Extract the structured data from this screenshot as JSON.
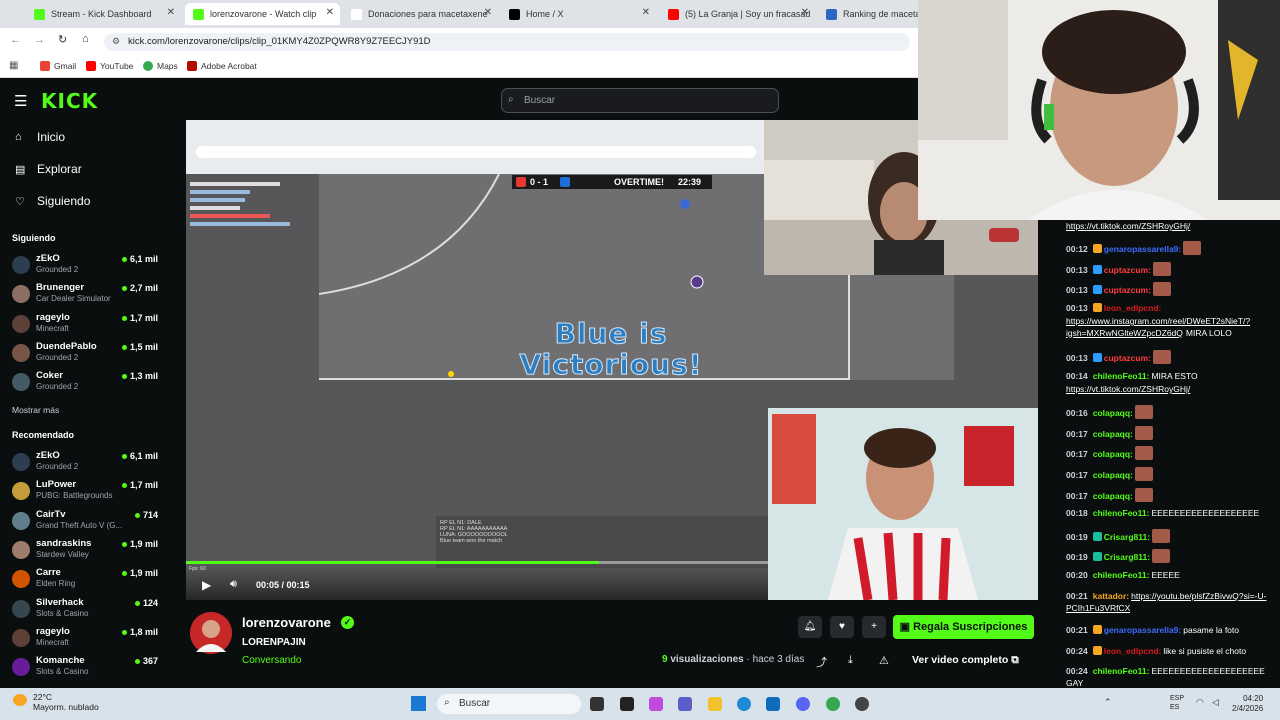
{
  "browser": {
    "tabs": [
      {
        "title": "Stream - Kick Dashboard",
        "color": "#53fc18"
      },
      {
        "title": "lorenzovarone - Watch clip",
        "color": "#53fc18"
      },
      {
        "title": "Donaciones para macetaxene",
        "color": "#ffffff"
      },
      {
        "title": "Home / X",
        "color": "#000000"
      },
      {
        "title": "(5) La Granja | Soy un fracasad",
        "color": "#ff0000"
      },
      {
        "title": "Ranking de macetaxer",
        "color": "#2b66c3"
      }
    ],
    "url": "kick.com/lorenzovarone/clips/clip_01KMY4Z0ZPQWR8Y9Z7EECJY91D",
    "bookmarks": [
      "Gmail",
      "YouTube",
      "Maps",
      "Adobe Acrobat"
    ]
  },
  "kick": {
    "logo": "KICK",
    "search_placeholder": "Buscar",
    "nav": [
      {
        "label": "Inicio",
        "icon": "home-icon"
      },
      {
        "label": "Explorar",
        "icon": "compass-icon"
      },
      {
        "label": "Siguiendo",
        "icon": "heart-icon"
      }
    ],
    "following_title": "Siguiendo",
    "following": [
      {
        "name": "zEkO",
        "game": "Grounded 2",
        "viewers": "6,1 mil",
        "color": "#2c3e50"
      },
      {
        "name": "Brunenger",
        "game": "Car Dealer Simulator",
        "viewers": "2,7 mil",
        "color": "#8d6e63"
      },
      {
        "name": "rageylo",
        "game": "Minecraft",
        "viewers": "1,7 mil",
        "color": "#5d4037"
      },
      {
        "name": "DuendePablo",
        "game": "Grounded 2",
        "viewers": "1,5 mil",
        "color": "#795548"
      },
      {
        "name": "Coker",
        "game": "Grounded 2",
        "viewers": "1,3 mil",
        "color": "#455a64"
      }
    ],
    "show_more": "Mostrar más",
    "recommended_title": "Recomendado",
    "recommended": [
      {
        "name": "zEkO",
        "game": "Grounded 2",
        "viewers": "6,1 mil",
        "color": "#2c3e50"
      },
      {
        "name": "LuPower",
        "game": "PUBG: Battlegrounds",
        "viewers": "1,7 mil",
        "color": "#c69c3b"
      },
      {
        "name": "CairTv",
        "game": "Grand Theft Auto V (G...",
        "viewers": "714",
        "color": "#607d8b"
      },
      {
        "name": "sandraskins",
        "game": "Stardew Valley",
        "viewers": "1,9 mil",
        "color": "#9e7b6b"
      },
      {
        "name": "Carre",
        "game": "Elden Ring",
        "viewers": "1,9 mil",
        "color": "#d35400"
      },
      {
        "name": "Silverhack",
        "game": "Slots & Casino",
        "viewers": "124",
        "color": "#37474f"
      },
      {
        "name": "rageylo",
        "game": "Minecraft",
        "viewers": "1,8 mil",
        "color": "#5d4037"
      },
      {
        "name": "Komanche",
        "game": "Slots & Casino",
        "viewers": "367",
        "color": "#6a1b9a"
      }
    ]
  },
  "video": {
    "score": "0 - 1",
    "overtime": "OVERTIME!",
    "clock": "22:39",
    "victory_line1": "Blue is",
    "victory_line2": "Victorious!",
    "time": "00:05 / 00:15",
    "progress_fraction": 0.71,
    "overlay_lines": [
      "RP EL N1: DALE",
      "RP EL N1: AAAAAAAAAAA",
      "LUNA: GOOOOOOOOOOL",
      "Blue team won the match"
    ],
    "fps": "Fps: 60"
  },
  "clip": {
    "streamer": "lorenzovarone",
    "title": "LORENPAJIN",
    "category": "Conversando",
    "views_count": "9",
    "views_label": "visualizaciones",
    "age": "· hace 3 días",
    "subscribe_label": "Regala Suscripciones",
    "full_video_label": "Ver video completo"
  },
  "chat": [
    {
      "time": "",
      "user": "",
      "text": "https://vt.tiktok.com/ZSHRoyGHj/",
      "link": true,
      "ucolor": "#ffffff",
      "emote": false,
      "badge": ""
    },
    {
      "time": "00:12",
      "user": "genaropassarella9:",
      "text": "",
      "link": false,
      "ucolor": "#3b6dff",
      "emote": true,
      "badge": "#f5a623"
    },
    {
      "time": "00:13",
      "user": "cuptazcum:",
      "text": "",
      "link": false,
      "ucolor": "#ff3c3c",
      "emote": true,
      "badge": "#2e9cff"
    },
    {
      "time": "00:13",
      "user": "cuptazcum:",
      "text": "",
      "link": false,
      "ucolor": "#ff3c3c",
      "emote": true,
      "badge": "#2e9cff"
    },
    {
      "time": "00:13",
      "user": "leon_edlpcnd:",
      "text": "",
      "link": false,
      "ucolor": "#d81b1b",
      "emote": false,
      "badge": "#f5a623"
    },
    {
      "time": "",
      "user": "",
      "text": "https://www.instagram.com/reel/DWeET2sNieT/?igsh=MXRwNGlteWZpcDZ6dQ",
      "link": true,
      "ucolor": "#ffffff",
      "emote": false,
      "badge": "",
      "suffix": "MIRA LOLO"
    },
    {
      "time": "00:13",
      "user": "cuptazcum:",
      "text": "",
      "link": false,
      "ucolor": "#ff3c3c",
      "emote": true,
      "badge": "#2e9cff"
    },
    {
      "time": "00:14",
      "user": "chilenoFeo11:",
      "text": "MIRA ESTO",
      "link": false,
      "ucolor": "#53fc18",
      "emote": false,
      "badge": ""
    },
    {
      "time": "",
      "user": "",
      "text": "https://vt.tiktok.com/ZSHRoyGHj/",
      "link": true,
      "ucolor": "#ffffff",
      "emote": false,
      "badge": ""
    },
    {
      "time": "00:16",
      "user": "colapaqq:",
      "text": "",
      "link": false,
      "ucolor": "#53fc18",
      "emote": true,
      "badge": ""
    },
    {
      "time": "00:17",
      "user": "colapaqq:",
      "text": "",
      "link": false,
      "ucolor": "#53fc18",
      "emote": true,
      "badge": ""
    },
    {
      "time": "00:17",
      "user": "colapaqq:",
      "text": "",
      "link": false,
      "ucolor": "#53fc18",
      "emote": true,
      "badge": ""
    },
    {
      "time": "00:17",
      "user": "colapaqq:",
      "text": "",
      "link": false,
      "ucolor": "#53fc18",
      "emote": true,
      "badge": ""
    },
    {
      "time": "00:17",
      "user": "colapaqq:",
      "text": "",
      "link": false,
      "ucolor": "#53fc18",
      "emote": true,
      "badge": ""
    },
    {
      "time": "00:18",
      "user": "chilenoFeo11:",
      "text": "EEEEEEEEEEEEEEEEEEE",
      "link": false,
      "ucolor": "#53fc18",
      "emote": false,
      "badge": ""
    },
    {
      "time": "00:19",
      "user": "Crisarg811:",
      "text": "",
      "link": false,
      "ucolor": "#53fc18",
      "emote": true,
      "badge": "#1abc9c"
    },
    {
      "time": "00:19",
      "user": "Crisarg811:",
      "text": "",
      "link": false,
      "ucolor": "#53fc18",
      "emote": true,
      "badge": "#1abc9c"
    },
    {
      "time": "00:20",
      "user": "chilenoFeo11:",
      "text": "EEEEE",
      "link": false,
      "ucolor": "#53fc18",
      "emote": false,
      "badge": ""
    },
    {
      "time": "00:21",
      "user": "kattador:",
      "text": "https://youtu.be/plsfZzBivwQ?si=-U-PCIh1Fu3VRfCX",
      "link": true,
      "ucolor": "#f5a623",
      "emote": false,
      "badge": ""
    },
    {
      "time": "00:21",
      "user": "genaropassarella9:",
      "text": "pasame la foto",
      "link": false,
      "ucolor": "#3b6dff",
      "emote": false,
      "badge": "#f5a623"
    },
    {
      "time": "00:24",
      "user": "leon_edlpcnd:",
      "text": "like si pusiste el choto",
      "link": false,
      "ucolor": "#d81b1b",
      "emote": false,
      "badge": "#f5a623"
    },
    {
      "time": "00:24",
      "user": "chilenoFeo11:",
      "text": "EEEEEEEEEEEEEEEEEEEE GAY",
      "link": false,
      "ucolor": "#53fc18",
      "emote": false,
      "badge": ""
    }
  ],
  "taskbar": {
    "temp": "22°C",
    "weather": "Mayorm. nublado",
    "search": "Buscar",
    "lang1": "ESP",
    "lang2": "ES",
    "time": "04:20",
    "date": "2/4/2026"
  }
}
